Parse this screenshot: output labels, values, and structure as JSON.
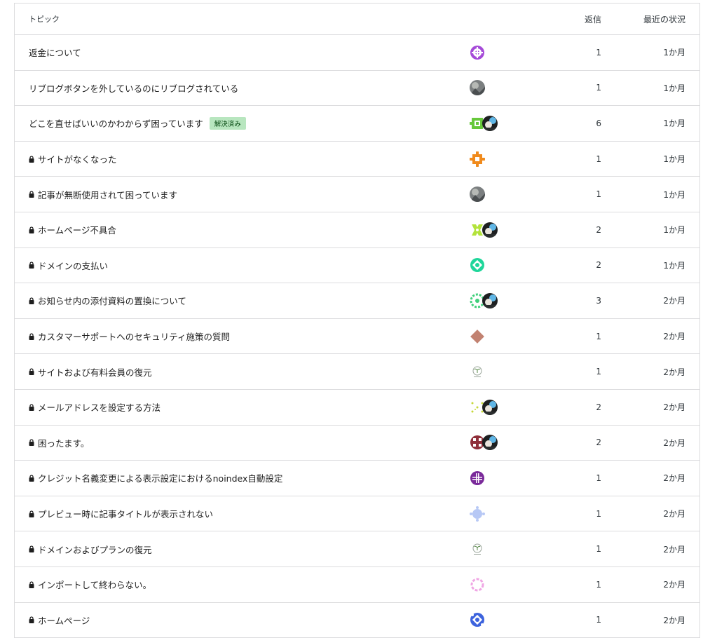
{
  "header": {
    "topic": "トピック",
    "replies": "返信",
    "activity": "最近の状況"
  },
  "colors": {
    "border": "#dcdcde",
    "badge_bg": "#b8e6bf",
    "badge_text": "#00450c"
  },
  "rows": [
    {
      "title": "返金について",
      "locked": false,
      "badge": "",
      "replies": "1",
      "activity": "1か月",
      "avatars": [
        "purple-pattern"
      ]
    },
    {
      "title": "リブログボタンを外しているのにリブログされている",
      "locked": false,
      "badge": "",
      "replies": "1",
      "activity": "1か月",
      "avatars": [
        "photo-gray"
      ]
    },
    {
      "title": "どこを直せばいいのかわからず困っています",
      "locked": false,
      "badge": "解決済み",
      "replies": "6",
      "activity": "1か月",
      "avatars": [
        "green-pattern",
        "support-photo"
      ]
    },
    {
      "title": "サイトがなくなった",
      "locked": true,
      "badge": "",
      "replies": "1",
      "activity": "1か月",
      "avatars": [
        "orange-pattern"
      ]
    },
    {
      "title": "記事が無断使用されて困っています",
      "locked": true,
      "badge": "",
      "replies": "1",
      "activity": "1か月",
      "avatars": [
        "photo-gray"
      ]
    },
    {
      "title": "ホームページ不具合",
      "locked": true,
      "badge": "",
      "replies": "2",
      "activity": "1か月",
      "avatars": [
        "lime-pattern",
        "support-photo"
      ]
    },
    {
      "title": "ドメインの支払い",
      "locked": true,
      "badge": "",
      "replies": "2",
      "activity": "1か月",
      "avatars": [
        "mint-pattern"
      ]
    },
    {
      "title": "お知らせ内の添付資料の置換について",
      "locked": true,
      "badge": "",
      "replies": "3",
      "activity": "2か月",
      "avatars": [
        "green-ring-pattern",
        "support-photo"
      ]
    },
    {
      "title": "カスタマーサポートへのセキュリティ施策の質問",
      "locked": true,
      "badge": "",
      "replies": "1",
      "activity": "2か月",
      "avatars": [
        "brown-diamond"
      ]
    },
    {
      "title": "サイトおよび有料会員の復元",
      "locked": true,
      "badge": "",
      "replies": "1",
      "activity": "2か月",
      "avatars": [
        "plant-logo"
      ]
    },
    {
      "title": "メールアドレスを設定する方法",
      "locked": true,
      "badge": "",
      "replies": "2",
      "activity": "2か月",
      "avatars": [
        "yellow-dots",
        "support-photo"
      ]
    },
    {
      "title": "困ったます。",
      "locked": true,
      "badge": "",
      "replies": "2",
      "activity": "2か月",
      "avatars": [
        "maroon-pattern",
        "support-photo"
      ]
    },
    {
      "title": "クレジット名義変更による表示設定におけるnoindex自動設定",
      "locked": true,
      "badge": "",
      "replies": "1",
      "activity": "2か月",
      "avatars": [
        "violet-pattern"
      ]
    },
    {
      "title": "プレビュー時に記事タイトルが表示されない",
      "locked": true,
      "badge": "",
      "replies": "1",
      "activity": "2か月",
      "avatars": [
        "lavender-pattern"
      ]
    },
    {
      "title": "ドメインおよびプランの復元",
      "locked": true,
      "badge": "",
      "replies": "1",
      "activity": "2か月",
      "avatars": [
        "plant-logo"
      ]
    },
    {
      "title": "インポートして終わらない。",
      "locked": true,
      "badge": "",
      "replies": "1",
      "activity": "2か月",
      "avatars": [
        "pink-ring-pattern"
      ]
    },
    {
      "title": "ホームページ",
      "locked": true,
      "badge": "",
      "replies": "1",
      "activity": "2か月",
      "avatars": [
        "blue-pattern"
      ]
    }
  ]
}
